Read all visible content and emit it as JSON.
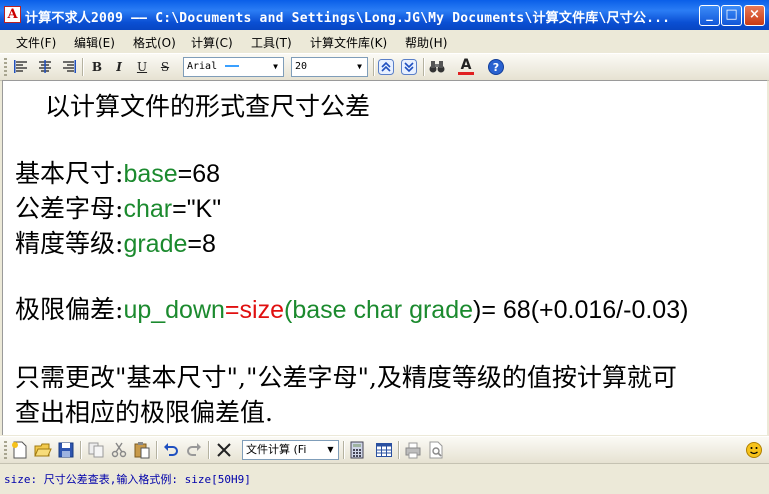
{
  "window": {
    "title": "计算不求人2009 —— C:\\Documents and Settings\\Long.JG\\My Documents\\计算文件库\\尺寸公...",
    "icon_glyph": "A",
    "controls": {
      "minimize": "_",
      "maximize": "□",
      "close": "×"
    }
  },
  "menu": [
    "文件(F)",
    "编辑(E)",
    "格式(O)",
    "计算(C)",
    "工具(T)",
    "计算文件库(K)",
    "帮助(H)"
  ],
  "toolbar": {
    "font_name": "Arial",
    "font_size": "20",
    "bold": "B",
    "italic": "I",
    "underline": "U",
    "strike": "S",
    "icons": [
      "align-left-icon",
      "align-center-icon",
      "align-right-icon",
      "bold-icon",
      "italic-icon",
      "underline-icon",
      "strikethrough-icon",
      "move-up-icon",
      "move-down-icon",
      "binoculars-icon",
      "font-color-icon",
      "help-icon"
    ]
  },
  "document": {
    "heading": "以计算文件的形式查尺寸公差",
    "lines": [
      {
        "label": "基本尺寸:",
        "var": "base",
        "op": "=",
        "val": "68"
      },
      {
        "label": "公差字母:",
        "var": "char",
        "op": "=",
        "val": "\"K\""
      },
      {
        "label": "精度等级:",
        "var": "grade",
        "op": "=",
        "val": "8"
      }
    ],
    "formula": {
      "label": "极限偏差:",
      "var": "up_down",
      "eq": "=",
      "func": "size",
      "open": "(",
      "args": "base char grade",
      "close": ")",
      "result": "= 68(+0.016/-0.03)"
    },
    "note_line1": "只需更改\"基本尺寸\",\"公差字母\",及精度等级的值按计算就可",
    "note_line2": "查出相应的极限偏差值."
  },
  "bottom_toolbar": {
    "combo_value": "文件计算 (Fi",
    "icons": [
      "new-file-icon",
      "open-folder-icon",
      "save-icon",
      "copy-icon",
      "cut-icon",
      "paste-icon",
      "undo-icon",
      "redo-icon",
      "delete-icon",
      "calculator-icon",
      "table-icon",
      "print-icon",
      "print-preview-icon",
      "smiley-icon"
    ]
  },
  "status": "size: 尺寸公差查表,输入格式例: size[50H9]",
  "colors": {
    "accent_green": "#1B8A2E",
    "accent_red": "#E01010",
    "title_blue": "#0A5FE8"
  }
}
